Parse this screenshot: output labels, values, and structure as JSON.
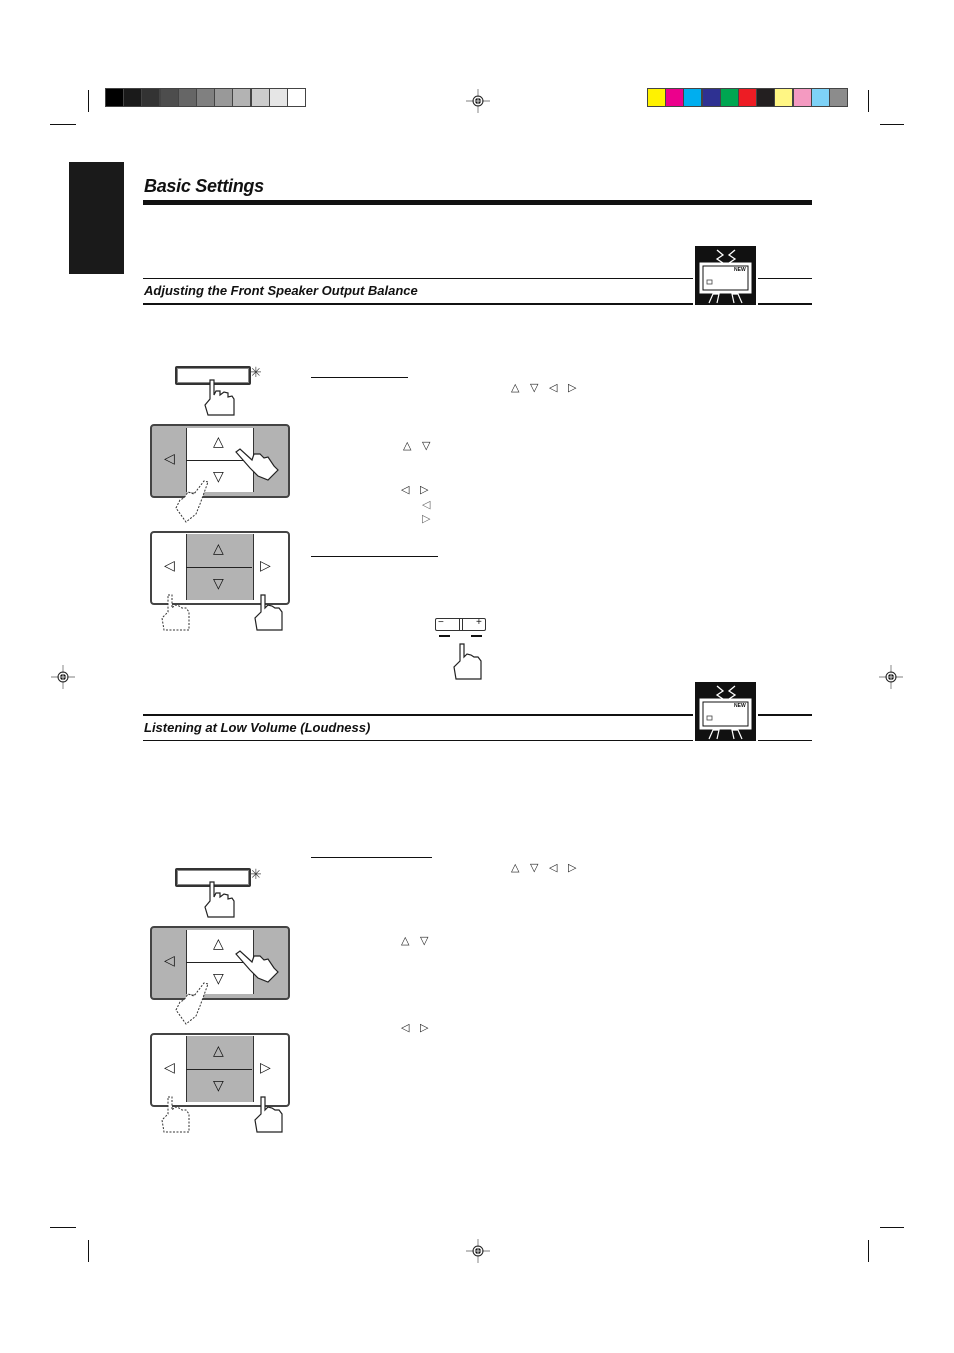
{
  "page": {
    "title": "Basic Settings",
    "sections": [
      {
        "id": "front-balance",
        "heading": "Adjusting the Front Speaker Output Balance"
      },
      {
        "id": "loudness",
        "heading": "Listening at Low Volume (Loudness)"
      }
    ]
  },
  "color_bars": {
    "gray": [
      "#000000",
      "#1a1a1a",
      "#333333",
      "#4d4d4d",
      "#666666",
      "#808080",
      "#999999",
      "#b3b3b3",
      "#cccccc",
      "#e6e6e6",
      "#ffffff"
    ],
    "color": [
      "#fff200",
      "#ec008c",
      "#00aeef",
      "#2e3192",
      "#00a651",
      "#ed1c24",
      "#231f20",
      "#fff684",
      "#f49ac1",
      "#7ed2f7",
      "#8c8c8c"
    ]
  },
  "icons": {
    "up": "△",
    "down": "▽",
    "left": "◁",
    "right": "▷",
    "minus": "−",
    "plus": "+",
    "star": "✳"
  },
  "tv_badge": {
    "label": "NEW"
  }
}
